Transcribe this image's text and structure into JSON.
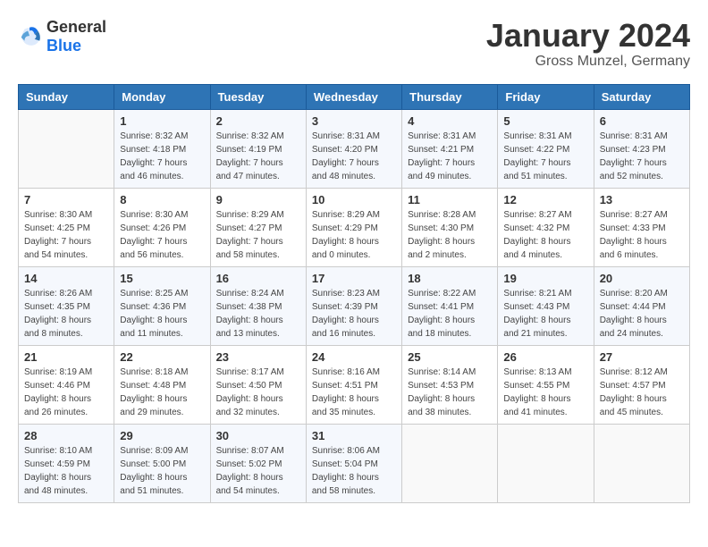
{
  "logo": {
    "general": "General",
    "blue": "Blue"
  },
  "header": {
    "month": "January 2024",
    "location": "Gross Munzel, Germany"
  },
  "weekdays": [
    "Sunday",
    "Monday",
    "Tuesday",
    "Wednesday",
    "Thursday",
    "Friday",
    "Saturday"
  ],
  "weeks": [
    [
      {
        "day": "",
        "sunrise": "",
        "sunset": "",
        "daylight": ""
      },
      {
        "day": "1",
        "sunrise": "Sunrise: 8:32 AM",
        "sunset": "Sunset: 4:18 PM",
        "daylight": "Daylight: 7 hours and 46 minutes."
      },
      {
        "day": "2",
        "sunrise": "Sunrise: 8:32 AM",
        "sunset": "Sunset: 4:19 PM",
        "daylight": "Daylight: 7 hours and 47 minutes."
      },
      {
        "day": "3",
        "sunrise": "Sunrise: 8:31 AM",
        "sunset": "Sunset: 4:20 PM",
        "daylight": "Daylight: 7 hours and 48 minutes."
      },
      {
        "day": "4",
        "sunrise": "Sunrise: 8:31 AM",
        "sunset": "Sunset: 4:21 PM",
        "daylight": "Daylight: 7 hours and 49 minutes."
      },
      {
        "day": "5",
        "sunrise": "Sunrise: 8:31 AM",
        "sunset": "Sunset: 4:22 PM",
        "daylight": "Daylight: 7 hours and 51 minutes."
      },
      {
        "day": "6",
        "sunrise": "Sunrise: 8:31 AM",
        "sunset": "Sunset: 4:23 PM",
        "daylight": "Daylight: 7 hours and 52 minutes."
      }
    ],
    [
      {
        "day": "7",
        "sunrise": "Sunrise: 8:30 AM",
        "sunset": "Sunset: 4:25 PM",
        "daylight": "Daylight: 7 hours and 54 minutes."
      },
      {
        "day": "8",
        "sunrise": "Sunrise: 8:30 AM",
        "sunset": "Sunset: 4:26 PM",
        "daylight": "Daylight: 7 hours and 56 minutes."
      },
      {
        "day": "9",
        "sunrise": "Sunrise: 8:29 AM",
        "sunset": "Sunset: 4:27 PM",
        "daylight": "Daylight: 7 hours and 58 minutes."
      },
      {
        "day": "10",
        "sunrise": "Sunrise: 8:29 AM",
        "sunset": "Sunset: 4:29 PM",
        "daylight": "Daylight: 8 hours and 0 minutes."
      },
      {
        "day": "11",
        "sunrise": "Sunrise: 8:28 AM",
        "sunset": "Sunset: 4:30 PM",
        "daylight": "Daylight: 8 hours and 2 minutes."
      },
      {
        "day": "12",
        "sunrise": "Sunrise: 8:27 AM",
        "sunset": "Sunset: 4:32 PM",
        "daylight": "Daylight: 8 hours and 4 minutes."
      },
      {
        "day": "13",
        "sunrise": "Sunrise: 8:27 AM",
        "sunset": "Sunset: 4:33 PM",
        "daylight": "Daylight: 8 hours and 6 minutes."
      }
    ],
    [
      {
        "day": "14",
        "sunrise": "Sunrise: 8:26 AM",
        "sunset": "Sunset: 4:35 PM",
        "daylight": "Daylight: 8 hours and 8 minutes."
      },
      {
        "day": "15",
        "sunrise": "Sunrise: 8:25 AM",
        "sunset": "Sunset: 4:36 PM",
        "daylight": "Daylight: 8 hours and 11 minutes."
      },
      {
        "day": "16",
        "sunrise": "Sunrise: 8:24 AM",
        "sunset": "Sunset: 4:38 PM",
        "daylight": "Daylight: 8 hours and 13 minutes."
      },
      {
        "day": "17",
        "sunrise": "Sunrise: 8:23 AM",
        "sunset": "Sunset: 4:39 PM",
        "daylight": "Daylight: 8 hours and 16 minutes."
      },
      {
        "day": "18",
        "sunrise": "Sunrise: 8:22 AM",
        "sunset": "Sunset: 4:41 PM",
        "daylight": "Daylight: 8 hours and 18 minutes."
      },
      {
        "day": "19",
        "sunrise": "Sunrise: 8:21 AM",
        "sunset": "Sunset: 4:43 PM",
        "daylight": "Daylight: 8 hours and 21 minutes."
      },
      {
        "day": "20",
        "sunrise": "Sunrise: 8:20 AM",
        "sunset": "Sunset: 4:44 PM",
        "daylight": "Daylight: 8 hours and 24 minutes."
      }
    ],
    [
      {
        "day": "21",
        "sunrise": "Sunrise: 8:19 AM",
        "sunset": "Sunset: 4:46 PM",
        "daylight": "Daylight: 8 hours and 26 minutes."
      },
      {
        "day": "22",
        "sunrise": "Sunrise: 8:18 AM",
        "sunset": "Sunset: 4:48 PM",
        "daylight": "Daylight: 8 hours and 29 minutes."
      },
      {
        "day": "23",
        "sunrise": "Sunrise: 8:17 AM",
        "sunset": "Sunset: 4:50 PM",
        "daylight": "Daylight: 8 hours and 32 minutes."
      },
      {
        "day": "24",
        "sunrise": "Sunrise: 8:16 AM",
        "sunset": "Sunset: 4:51 PM",
        "daylight": "Daylight: 8 hours and 35 minutes."
      },
      {
        "day": "25",
        "sunrise": "Sunrise: 8:14 AM",
        "sunset": "Sunset: 4:53 PM",
        "daylight": "Daylight: 8 hours and 38 minutes."
      },
      {
        "day": "26",
        "sunrise": "Sunrise: 8:13 AM",
        "sunset": "Sunset: 4:55 PM",
        "daylight": "Daylight: 8 hours and 41 minutes."
      },
      {
        "day": "27",
        "sunrise": "Sunrise: 8:12 AM",
        "sunset": "Sunset: 4:57 PM",
        "daylight": "Daylight: 8 hours and 45 minutes."
      }
    ],
    [
      {
        "day": "28",
        "sunrise": "Sunrise: 8:10 AM",
        "sunset": "Sunset: 4:59 PM",
        "daylight": "Daylight: 8 hours and 48 minutes."
      },
      {
        "day": "29",
        "sunrise": "Sunrise: 8:09 AM",
        "sunset": "Sunset: 5:00 PM",
        "daylight": "Daylight: 8 hours and 51 minutes."
      },
      {
        "day": "30",
        "sunrise": "Sunrise: 8:07 AM",
        "sunset": "Sunset: 5:02 PM",
        "daylight": "Daylight: 8 hours and 54 minutes."
      },
      {
        "day": "31",
        "sunrise": "Sunrise: 8:06 AM",
        "sunset": "Sunset: 5:04 PM",
        "daylight": "Daylight: 8 hours and 58 minutes."
      },
      {
        "day": "",
        "sunrise": "",
        "sunset": "",
        "daylight": ""
      },
      {
        "day": "",
        "sunrise": "",
        "sunset": "",
        "daylight": ""
      },
      {
        "day": "",
        "sunrise": "",
        "sunset": "",
        "daylight": ""
      }
    ]
  ]
}
